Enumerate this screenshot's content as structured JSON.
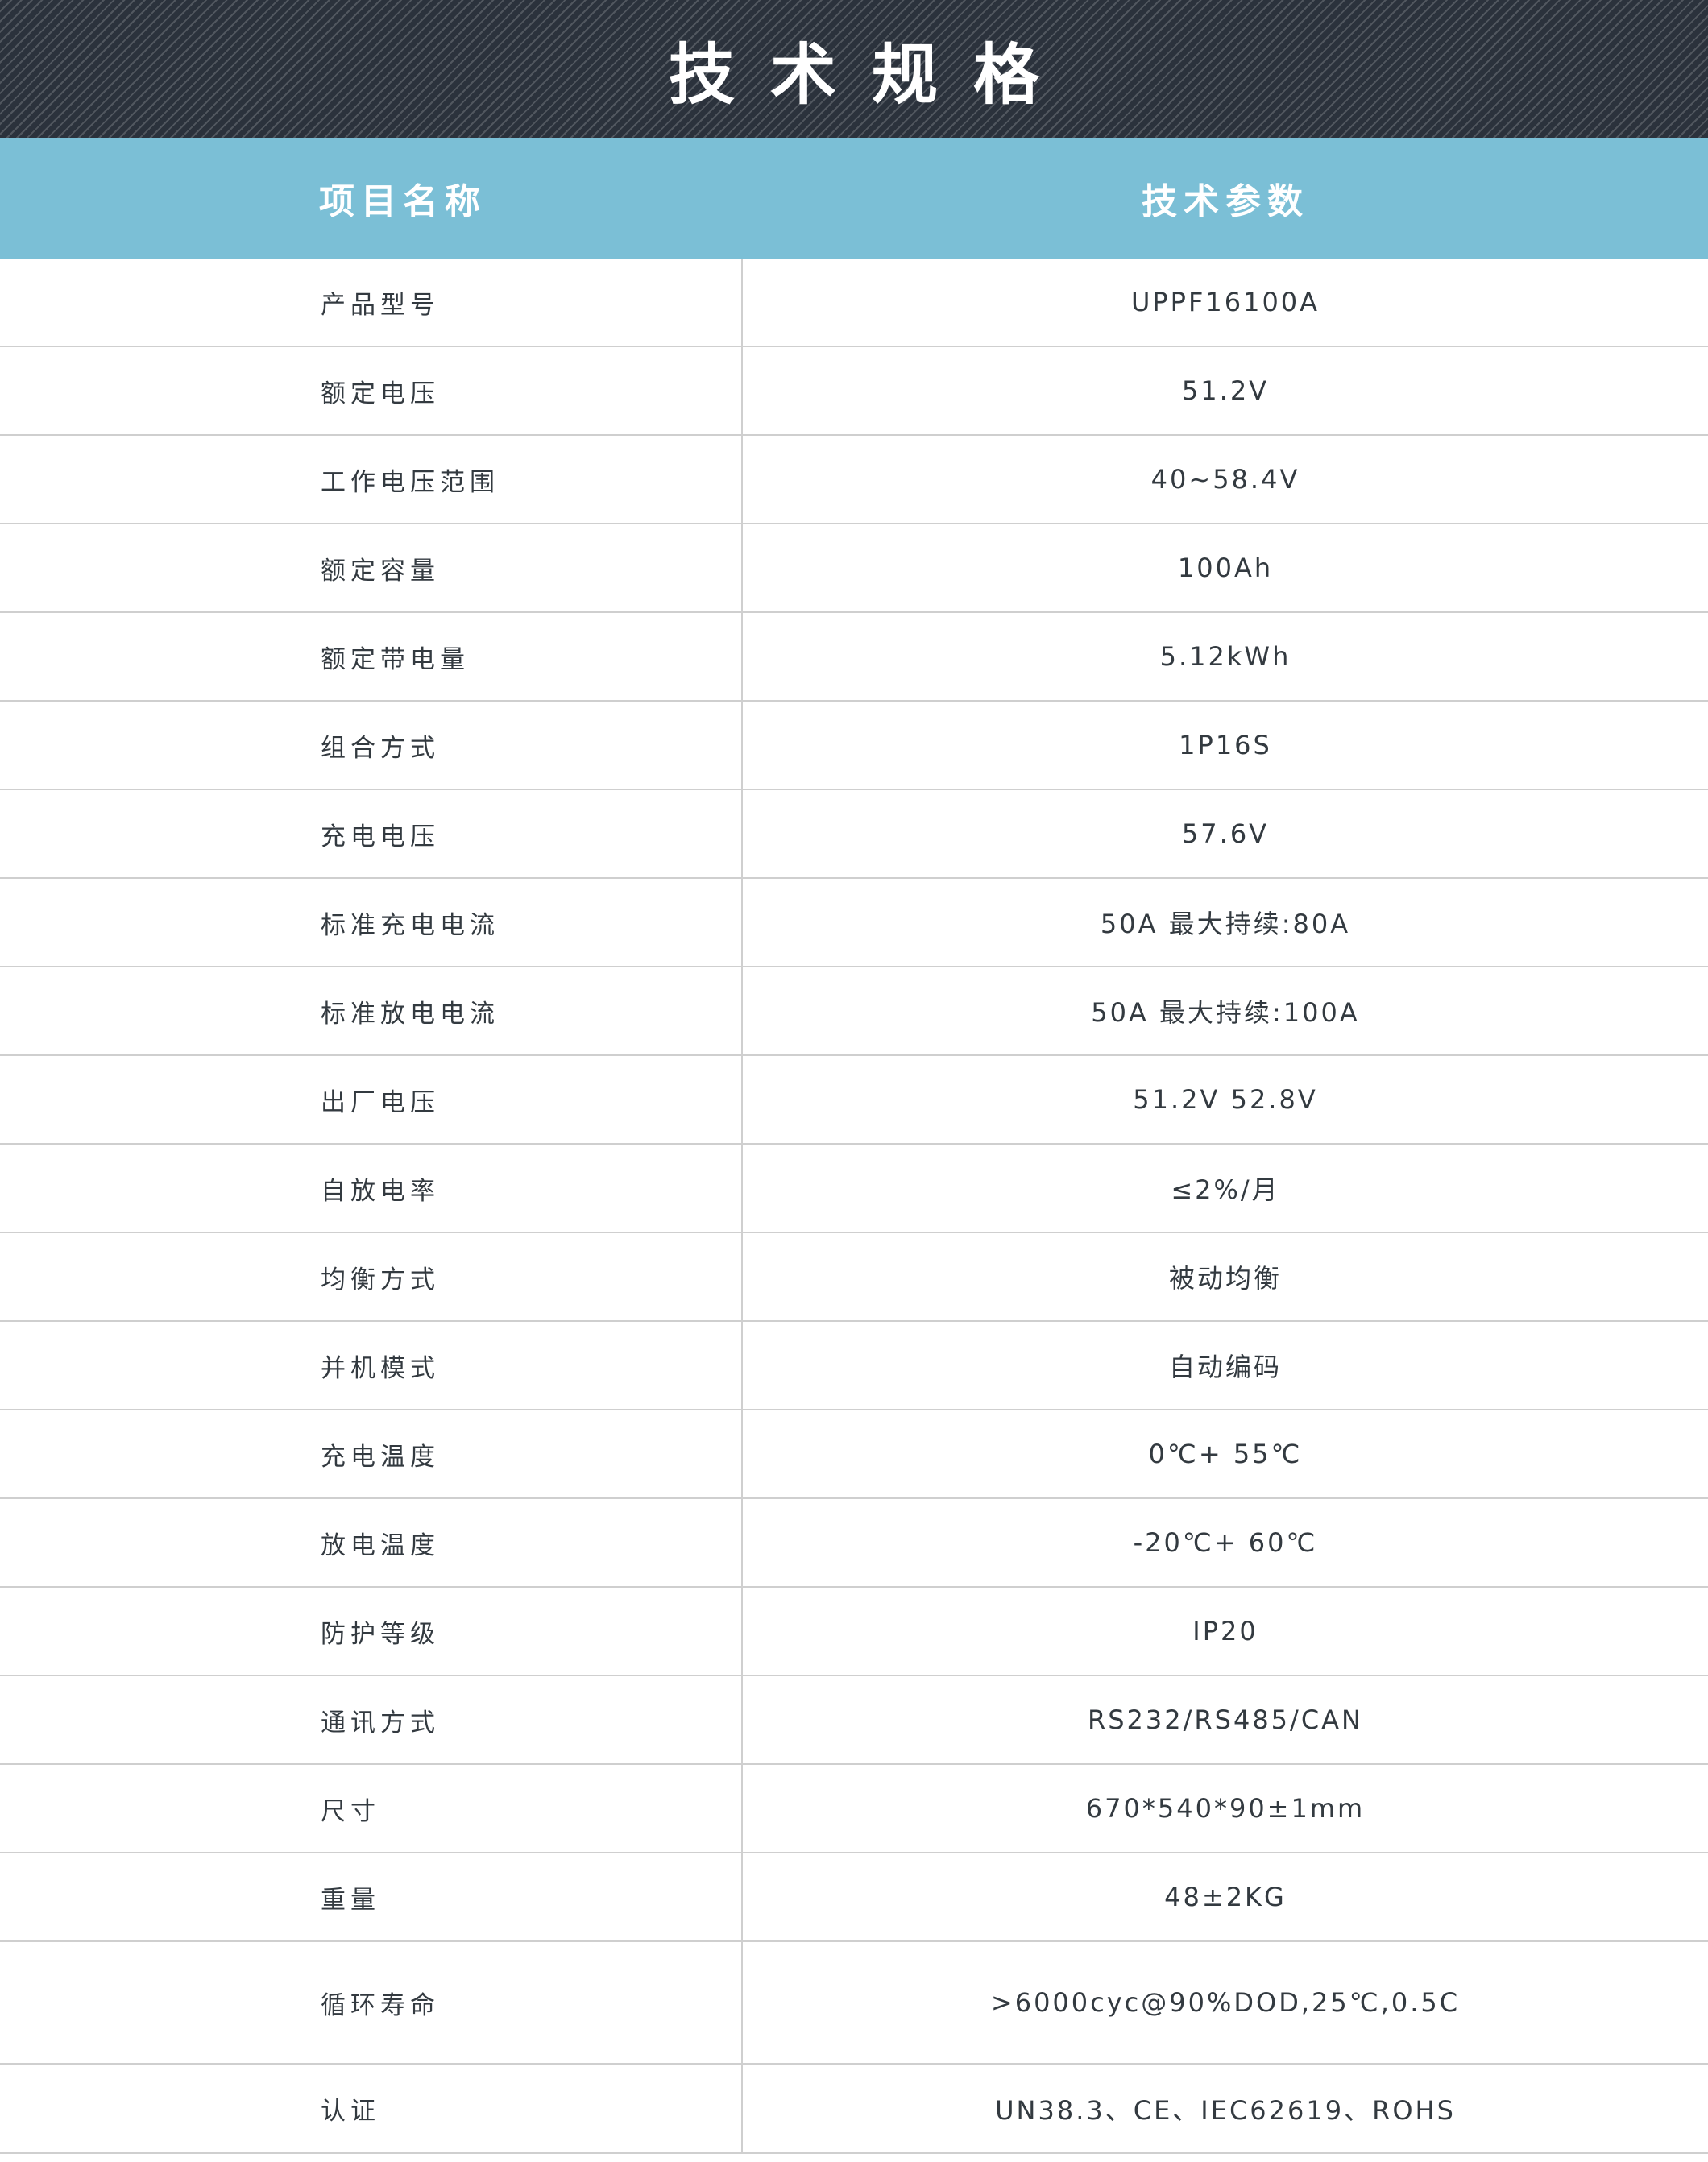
{
  "title": "技术规格",
  "header": {
    "name_col": "项目名称",
    "value_col": "技术参数"
  },
  "specs": [
    {
      "name": "产品型号",
      "value": "UPPF16100A"
    },
    {
      "name": "额定电压",
      "value": "51.2V"
    },
    {
      "name": "工作电压范围",
      "value": "40~58.4V"
    },
    {
      "name": "额定容量",
      "value": "100Ah"
    },
    {
      "name": "额定带电量",
      "value": "5.12kWh"
    },
    {
      "name": "组合方式",
      "value": "1P16S"
    },
    {
      "name": "充电电压",
      "value": "57.6V"
    },
    {
      "name": "标准充电电流",
      "value": "50A 最大持续:80A"
    },
    {
      "name": "标准放电电流",
      "value": "50A 最大持续:100A"
    },
    {
      "name": "出厂电压",
      "value": "51.2V 52.8V"
    },
    {
      "name": "自放电率",
      "value": "≤2%/月"
    },
    {
      "name": "均衡方式",
      "value": "被动均衡"
    },
    {
      "name": "并机模式",
      "value": "自动编码"
    },
    {
      "name": "充电温度",
      "value": "0℃+ 55℃"
    },
    {
      "name": "放电温度",
      "value": "-20℃+ 60℃"
    },
    {
      "name": "防护等级",
      "value": "IP20"
    },
    {
      "name": "通讯方式",
      "value": "RS232/RS485/CAN"
    },
    {
      "name": "尺寸",
      "value": "670*540*90±1mm"
    },
    {
      "name": "重量",
      "value": "48±2KG"
    },
    {
      "name": "循环寿命",
      "value": ">6000cyc@90%DOD,25℃,0.5C"
    },
    {
      "name": "认证",
      "value": "UN38.3、CE、IEC62619、ROHS"
    }
  ],
  "colors": {
    "title_band": "#2b323c",
    "header_band": "#7bbfd6",
    "text": "#333a40",
    "rule": "#cfcfcf"
  }
}
